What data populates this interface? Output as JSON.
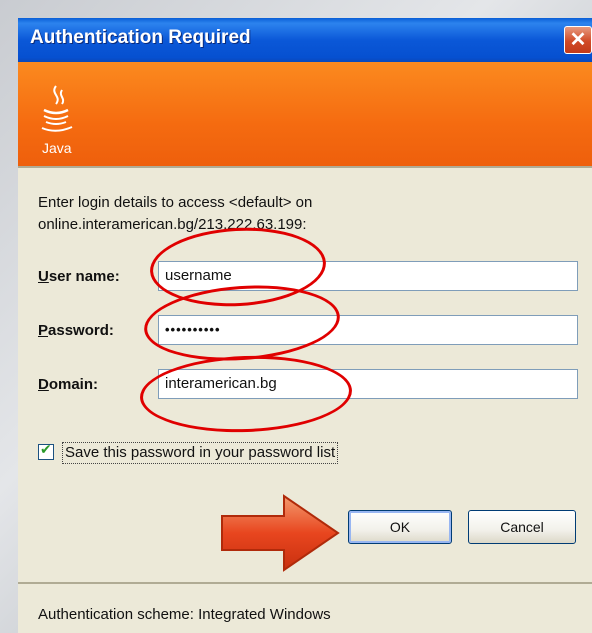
{
  "dialog": {
    "title": "Authentication Required",
    "close_icon": "close-icon",
    "banner": {
      "logo_icon": "java-logo-icon",
      "logo_text": "Java",
      "color": "#f56b10"
    },
    "prompt_line1": "Enter login details to access <default> on",
    "prompt_line2": "online.interamerican.bg/213.222.63.199:",
    "fields": {
      "username": {
        "label_first": "U",
        "label_rest": "ser name:",
        "value": "username"
      },
      "password": {
        "label_first": "P",
        "label_rest": "assword:",
        "value": "••••••••••"
      },
      "domain": {
        "label_first": "D",
        "label_rest": "omain:",
        "value": "interamerican.bg"
      }
    },
    "save_password": {
      "checked": true,
      "label": "Save this password in your password list"
    },
    "buttons": {
      "ok": "OK",
      "cancel": "Cancel"
    },
    "footer": "Authentication scheme: Integrated Windows"
  },
  "annotations": {
    "highlight_color": "#e00000",
    "arrow_color": "#e8461f"
  }
}
